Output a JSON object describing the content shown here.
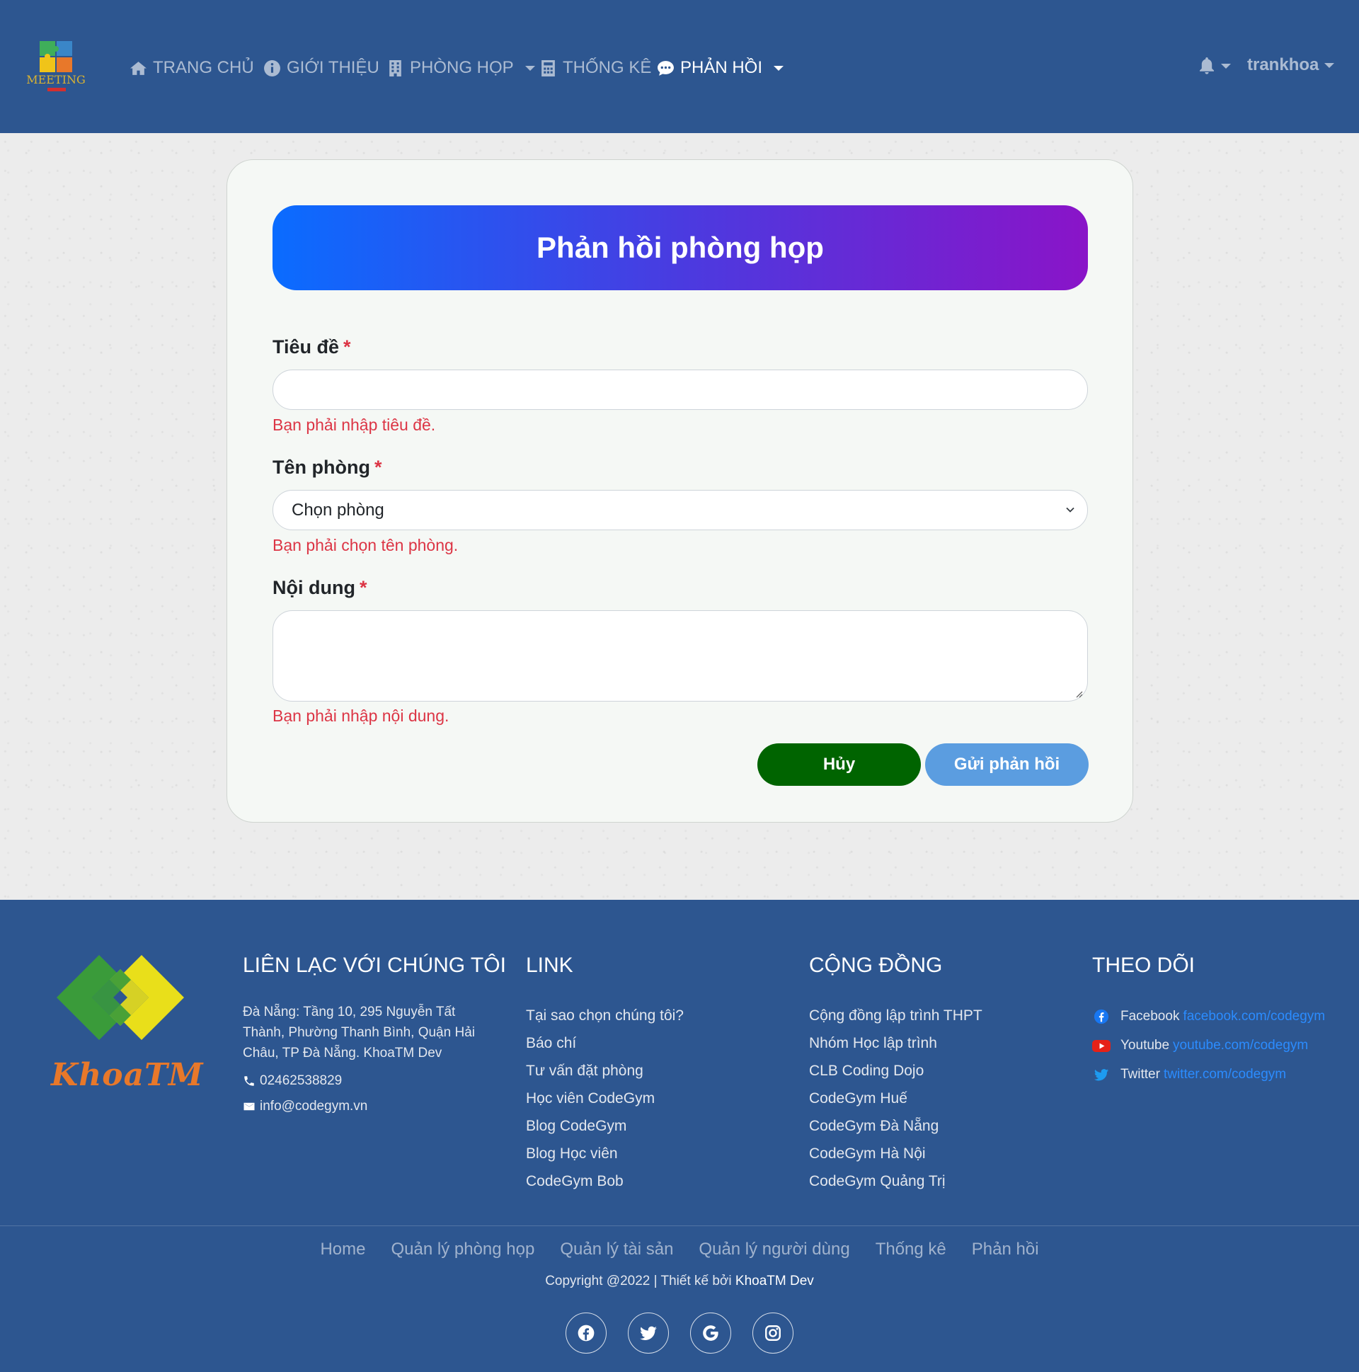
{
  "navbar": {
    "logo_text": "MEETING",
    "items": [
      {
        "label": "TRANG CHỦ",
        "icon": "home-icon"
      },
      {
        "label": "GIỚI THIỆU",
        "icon": "info-circle-icon"
      },
      {
        "label": "PHÒNG HỌP",
        "icon": "building-icon"
      },
      {
        "label": "THỐNG KÊ",
        "icon": "calculator-icon"
      },
      {
        "label": "PHẢN HỒI",
        "icon": "comment-dots-icon"
      }
    ],
    "active_item": "PHẢN HỒI",
    "notifications_icon": "bell-icon",
    "username": "trankhoa"
  },
  "form": {
    "title": "Phản hồi phòng họp",
    "required_mark": "*",
    "title_label": "Tiêu đề",
    "title_value": "",
    "title_error": "Bạn phải nhập tiêu đề.",
    "room_label": "Tên phòng",
    "room_selected": "Chọn phòng",
    "room_error": "Bạn phải chọn tên phòng.",
    "content_label": "Nội dung",
    "content_value": "",
    "content_error": "Bạn phải nhập nội dung.",
    "cancel_label": "Hủy",
    "submit_label": "Gửi phản hồi"
  },
  "footer": {
    "brand": "KhoaTM",
    "contact": {
      "heading": "LIÊN LẠC VỚI CHÚNG TÔI",
      "address": "Đà Nẵng: Tầng 10, 295 Nguyễn Tất Thành, Phường Thanh Bình, Quận Hải Châu, TP Đà Nẵng. KhoaTM Dev",
      "phone": "02462538829",
      "email": "info@codegym.vn"
    },
    "links": {
      "heading": "LINK",
      "items": [
        "Tại sao chọn chúng tôi?",
        "Báo chí",
        "Tư vấn đặt phòng",
        "Học viên CodeGym",
        "Blog CodeGym",
        "Blog Học viên",
        "CodeGym Bob"
      ]
    },
    "community": {
      "heading": "CỘNG ĐỒNG",
      "items": [
        "Cộng đồng lập trình THPT",
        "Nhóm Học lập trình",
        "CLB Coding Dojo",
        "CodeGym Huế",
        "CodeGym Đà Nẵng",
        "CodeGym Hà Nội",
        "CodeGym Quảng Trị"
      ]
    },
    "follow": {
      "heading": "THEO DÕI",
      "items": [
        {
          "name": "Facebook",
          "link": "facebook.com/codegym",
          "icon": "facebook-icon"
        },
        {
          "name": "Youtube",
          "link": "youtube.com/codegym",
          "icon": "youtube-icon"
        },
        {
          "name": "Twitter",
          "link": "twitter.com/codegym",
          "icon": "twitter-icon"
        }
      ]
    },
    "bottom_nav": [
      "Home",
      "Quản lý phòng họp",
      "Quản lý tài sản",
      "Quản lý người dùng",
      "Thống kê",
      "Phản hồi"
    ],
    "copyright_prefix": "Copyright @2022 | Thiết kế bởi",
    "copyright_author": "KhoaTM Dev",
    "social_icons": [
      "facebook-icon",
      "twitter-icon",
      "google-icon",
      "instagram-icon"
    ]
  },
  "colors": {
    "navbar_bg": "#2d5690",
    "header_gradient_start": "#0a6cff",
    "header_gradient_end": "#8a14c8",
    "error": "#dc3545",
    "cancel_button": "#006400",
    "submit_button": "#5b9de0",
    "follow_link": "#2b8cff"
  }
}
